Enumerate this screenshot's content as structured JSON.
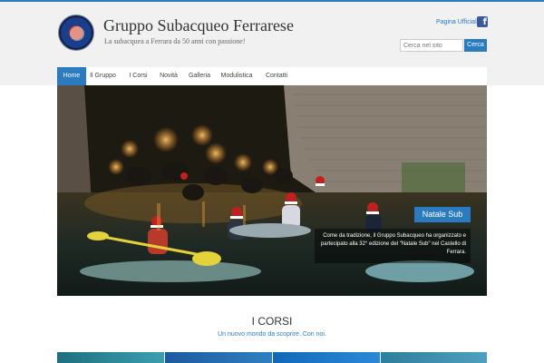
{
  "site": {
    "title": "Gruppo Subacqueo Ferrarese",
    "tagline": "La subacquea a Ferrara da 50 anni con passione!"
  },
  "header": {
    "facebook_label": "Pagina Ufficiale",
    "facebook_icon": "facebook-icon",
    "search_placeholder": "Cerca nel sito",
    "search_button": "Cerca"
  },
  "nav": {
    "items": [
      {
        "label": "Home",
        "active": true
      },
      {
        "label": "Il Gruppo",
        "active": false
      },
      {
        "label": "I Corsi",
        "active": false
      },
      {
        "label": "Novità",
        "active": false
      },
      {
        "label": "Galleria",
        "active": false
      },
      {
        "label": "Modulistica",
        "active": false
      },
      {
        "label": "Contatti",
        "active": false
      }
    ]
  },
  "slider": {
    "caption_title": "Natale Sub",
    "caption_text": "Come da tradizione, il Gruppo Subacqueo ha organizzato e partecipato alla 32° edizione del \"Natale Sub\" nel Castello di Ferrara.",
    "slide_count": 3,
    "active_slide": 1
  },
  "section": {
    "title": "I CORSI",
    "subtitle": "Un nuovo mondo da scoprire. Con noi."
  },
  "colors": {
    "accent": "#2b7bc0",
    "header_bg": "#f1f1f1",
    "facebook": "#3b5998"
  }
}
